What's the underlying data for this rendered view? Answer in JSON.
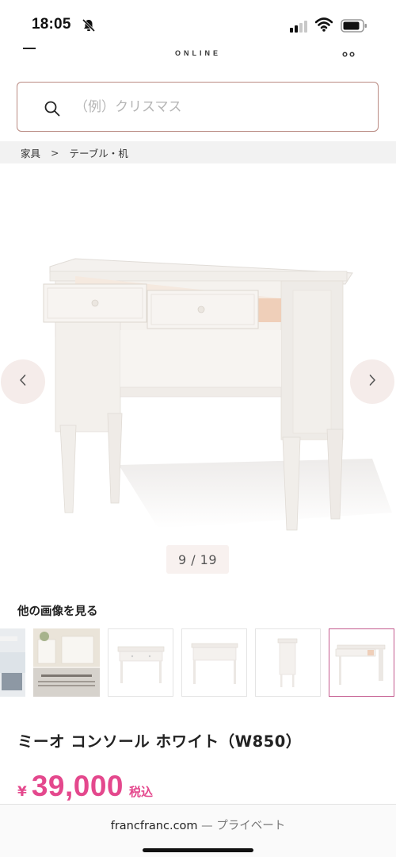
{
  "status_bar": {
    "time": "18:05",
    "icons": [
      "bell-slash-icon",
      "cellular-signal-icon",
      "wifi-icon",
      "battery-icon"
    ]
  },
  "header": {
    "brand": "ONLINE",
    "menu_icon": "hamburger-icon",
    "cart_icon": "cart-icon"
  },
  "search": {
    "placeholder": "（例）クリスマス",
    "value": ""
  },
  "breadcrumb": {
    "items": [
      "家具",
      "テーブル・机"
    ],
    "separator": ">"
  },
  "gallery": {
    "counter": "9 / 19",
    "prev_icon": "chevron-left-icon",
    "next_icon": "chevron-right-icon"
  },
  "more_images": {
    "title": "他の画像を見る"
  },
  "product": {
    "name": "ミーオ コンソール ホワイト（W850）",
    "price_currency": "¥",
    "price_value": "39,000",
    "price_tax": "税込"
  },
  "browser": {
    "domain": "francfranc.com",
    "separator": " — ",
    "subtitle": "プライベート"
  },
  "colors": {
    "accent_pink": "#e4488d",
    "selected_border": "#c45a8e",
    "search_border": "#b98a82",
    "arrow_bg": "#f5ecea"
  }
}
